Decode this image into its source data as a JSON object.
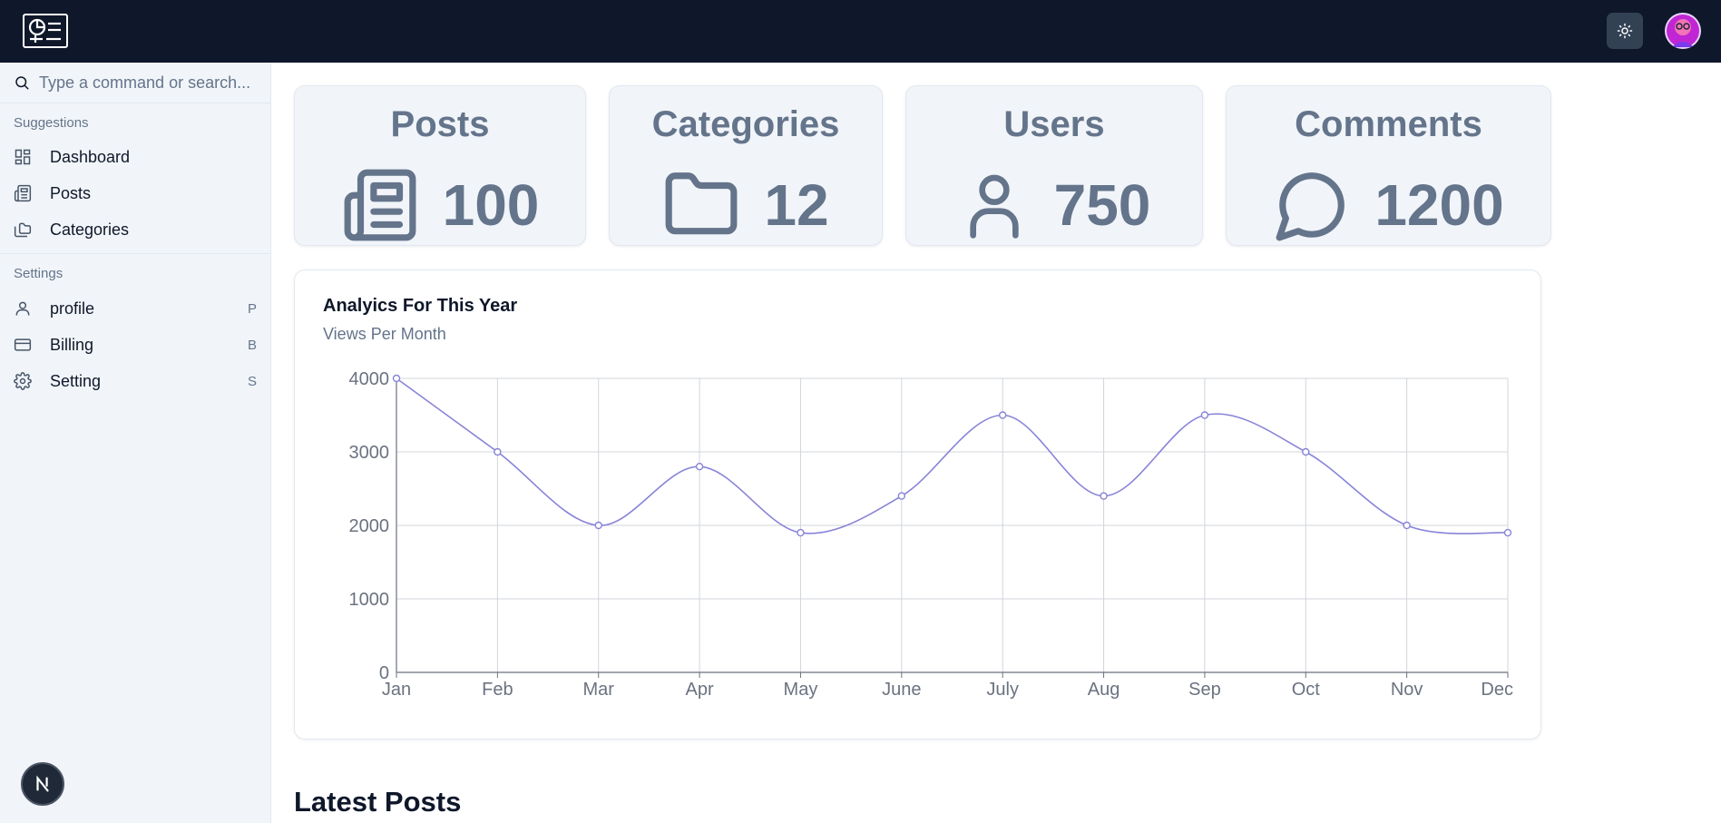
{
  "search": {
    "placeholder": "Type a command or search..."
  },
  "sidebar": {
    "suggestions_label": "Suggestions",
    "settings_label": "Settings",
    "suggestions": [
      {
        "label": "Dashboard",
        "icon": "dashboard-icon"
      },
      {
        "label": "Posts",
        "icon": "newspaper-icon"
      },
      {
        "label": "Categories",
        "icon": "folders-icon"
      }
    ],
    "settings": [
      {
        "label": "profile",
        "shortcut": "P",
        "icon": "user-icon"
      },
      {
        "label": "Billing",
        "shortcut": "B",
        "icon": "credit-card-icon"
      },
      {
        "label": "Setting",
        "shortcut": "S",
        "icon": "gear-icon"
      }
    ],
    "badge": "N"
  },
  "stats": [
    {
      "title": "Posts",
      "value": "100",
      "icon": "newspaper-icon"
    },
    {
      "title": "Categories",
      "value": "12",
      "icon": "folder-icon"
    },
    {
      "title": "Users",
      "value": "750",
      "icon": "user-icon"
    },
    {
      "title": "Comments",
      "value": "1200",
      "icon": "message-circle-icon"
    }
  ],
  "chart": {
    "title": "Analyics For This Year",
    "subtitle": "Views Per Month"
  },
  "chart_data": {
    "type": "line",
    "categories": [
      "Jan",
      "Feb",
      "Mar",
      "Apr",
      "May",
      "June",
      "July",
      "Aug",
      "Sep",
      "Oct",
      "Nov",
      "Dec"
    ],
    "values": [
      4000,
      3000,
      2000,
      2800,
      1900,
      2400,
      3500,
      2400,
      3500,
      3000,
      2000,
      1900
    ],
    "yticks": [
      0,
      1000,
      2000,
      3000,
      4000
    ],
    "ylim": [
      0,
      4000
    ],
    "grid": true,
    "curve": "smooth",
    "line_color": "#8884d8"
  },
  "latest_posts": {
    "title": "Latest Posts"
  },
  "colors": {
    "topbar": "#0f172a",
    "sidebar": "#f1f5f9",
    "card": "#f1f5f9",
    "muted": "#64748b",
    "accent": "#8884d8"
  }
}
